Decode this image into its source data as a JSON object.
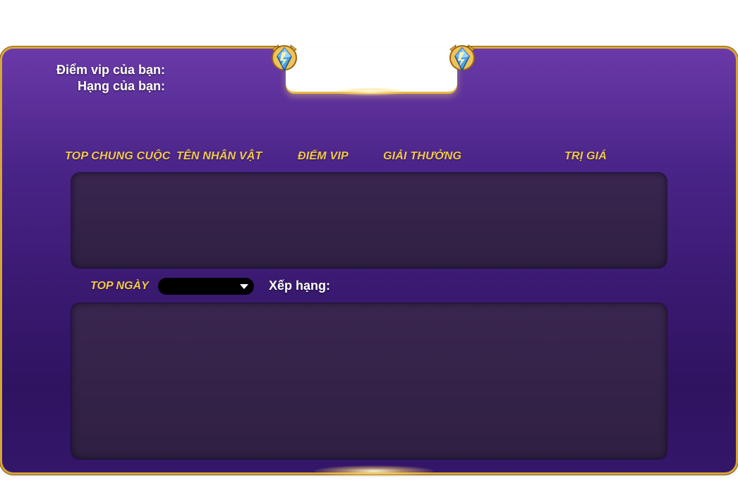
{
  "user_info": {
    "vip_points_label": "Điểm vip của bạn:",
    "rank_label": "Hạng của bạn:"
  },
  "overall_table": {
    "headers": [
      "TOP CHUNG CUỘC",
      "TÊN NHÂN VẬT",
      "ĐIỂM VIP",
      "GIẢI THƯỞNG",
      "TRỊ GIÁ"
    ],
    "rows": []
  },
  "daily": {
    "label": "TOP NGÀY",
    "select": {
      "selected": "",
      "icon": "chevron-down-icon"
    },
    "rank_label": "Xếp hạng:",
    "rows": []
  },
  "colors": {
    "panel_top": "#6a3aa8",
    "panel_bottom": "#2f1360",
    "gold": "#f2c94c",
    "border_gold": "#d8a637",
    "box_dark": "#2f2042"
  },
  "icons": {
    "left_emblem": "crystal-emblem-icon",
    "right_emblem": "crystal-emblem-icon"
  }
}
